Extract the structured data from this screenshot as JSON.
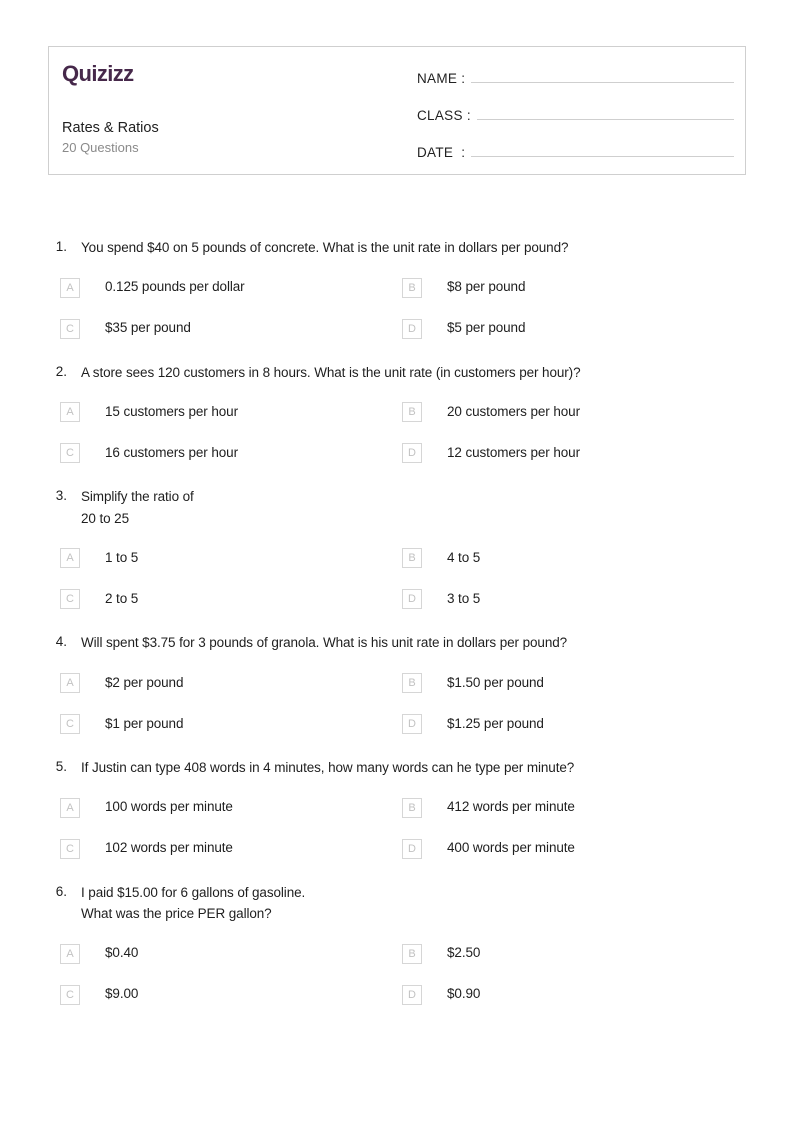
{
  "header": {
    "logo": "Quizizz",
    "logo_color": "#46284a",
    "title": "Rates & Ratios",
    "subtitle": "20 Questions",
    "fields": [
      {
        "label": "NAME :",
        "value": ""
      },
      {
        "label": "CLASS :",
        "value": ""
      },
      {
        "label": "DATE  :",
        "value": ""
      }
    ]
  },
  "questions": [
    {
      "number": "1.",
      "lines": [
        "You spend $40 on 5 pounds of concrete. What is the unit rate in dollars per pound?"
      ],
      "options": [
        {
          "letter": "A",
          "text": "0.125 pounds per dollar"
        },
        {
          "letter": "B",
          "text": "$8 per pound"
        },
        {
          "letter": "C",
          "text": "$35 per pound"
        },
        {
          "letter": "D",
          "text": "$5 per pound"
        }
      ]
    },
    {
      "number": "2.",
      "lines": [
        "A store sees 120 customers in 8 hours. What is the unit rate (in customers per hour)?"
      ],
      "options": [
        {
          "letter": "A",
          "text": "15 customers per hour"
        },
        {
          "letter": "B",
          "text": "20 customers per hour"
        },
        {
          "letter": "C",
          "text": "16 customers per hour"
        },
        {
          "letter": "D",
          "text": "12 customers per hour"
        }
      ]
    },
    {
      "number": "3.",
      "lines": [
        "Simplify the ratio of",
        "20 to 25"
      ],
      "options": [
        {
          "letter": "A",
          "text": "1 to 5"
        },
        {
          "letter": "B",
          "text": "4 to 5"
        },
        {
          "letter": "C",
          "text": "2 to 5"
        },
        {
          "letter": "D",
          "text": "3 to 5"
        }
      ]
    },
    {
      "number": "4.",
      "lines": [
        "Will spent $3.75 for 3 pounds of granola. What is his unit rate in dollars per pound?"
      ],
      "options": [
        {
          "letter": "A",
          "text": "$2 per pound"
        },
        {
          "letter": "B",
          "text": "$1.50 per pound"
        },
        {
          "letter": "C",
          "text": "$1 per pound"
        },
        {
          "letter": "D",
          "text": "$1.25 per pound"
        }
      ]
    },
    {
      "number": "5.",
      "lines": [
        "If Justin can type 408 words in 4 minutes, how many words can he type per minute?"
      ],
      "options": [
        {
          "letter": "A",
          "text": "100 words per minute"
        },
        {
          "letter": "B",
          "text": "412 words per minute"
        },
        {
          "letter": "C",
          "text": "102 words per minute"
        },
        {
          "letter": "D",
          "text": "400 words per minute"
        }
      ]
    },
    {
      "number": "6.",
      "lines": [
        "I paid $15.00 for 6 gallons of gasoline.",
        "What was the price PER gallon?"
      ],
      "options": [
        {
          "letter": "A",
          "text": "$0.40"
        },
        {
          "letter": "B",
          "text": "$2.50"
        },
        {
          "letter": "C",
          "text": "$9.00"
        },
        {
          "letter": "D",
          "text": "$0.90"
        }
      ]
    }
  ]
}
